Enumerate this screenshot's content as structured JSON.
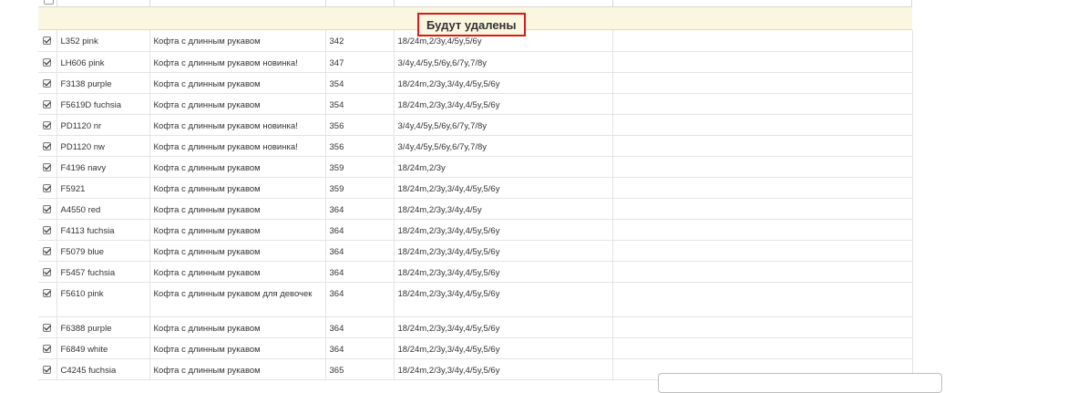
{
  "section": {
    "title": "Будут удалены"
  },
  "rows": [
    {
      "checked": true,
      "article": "L352 pink",
      "name": "Кофта с длинным рукавом",
      "price": "342",
      "sizes": "18/24m,2/3y,4/5y,5/6y"
    },
    {
      "checked": true,
      "article": "LH606 pink",
      "name": "Кофта с длинным рукавом новинка!",
      "price": "347",
      "sizes": "3/4y,4/5y,5/6y,6/7y,7/8y"
    },
    {
      "checked": true,
      "article": "F3138 purple",
      "name": "Кофта с длинным рукавом",
      "price": "354",
      "sizes": "18/24m,2/3y,3/4y,4/5y,5/6y"
    },
    {
      "checked": true,
      "article": "F5619D fuchsia",
      "name": "Кофта с длинным рукавом",
      "price": "354",
      "sizes": "18/24m,2/3y,3/4y,4/5y,5/6y"
    },
    {
      "checked": true,
      "article": "PD1120 nr",
      "name": "Кофта с длинным рукавом новинка!",
      "price": "356",
      "sizes": "3/4y,4/5y,5/6y,6/7y,7/8y"
    },
    {
      "checked": true,
      "article": "PD1120 nw",
      "name": "Кофта с длинным рукавом новинка!",
      "price": "356",
      "sizes": "3/4y,4/5y,5/6y,6/7y,7/8y"
    },
    {
      "checked": true,
      "article": "F4196 navy",
      "name": "Кофта с длинным рукавом",
      "price": "359",
      "sizes": "18/24m,2/3y"
    },
    {
      "checked": true,
      "article": "F5921",
      "name": "Кофта с длинным рукавом",
      "price": "359",
      "sizes": "18/24m,2/3y,3/4y,4/5y,5/6y"
    },
    {
      "checked": true,
      "article": "A4550 red",
      "name": "Кофта с длинным рукавом",
      "price": "364",
      "sizes": "18/24m,2/3y,3/4y,4/5y"
    },
    {
      "checked": true,
      "article": "F4113 fuchsia",
      "name": "Кофта с длинным рукавом",
      "price": "364",
      "sizes": "18/24m,2/3y,3/4y,4/5y,5/6y"
    },
    {
      "checked": true,
      "article": "F5079 blue",
      "name": "Кофта с длинным рукавом",
      "price": "364",
      "sizes": "18/24m,2/3y,3/4y,4/5y,5/6y"
    },
    {
      "checked": true,
      "article": "F5457 fuchsia",
      "name": "Кофта с длинным рукавом",
      "price": "364",
      "sizes": "18/24m,2/3y,3/4y,4/5y,5/6y"
    },
    {
      "checked": true,
      "article": "F5610 pink",
      "name": "Кофта с длинным рукавом для девочек",
      "price": "364",
      "sizes": "18/24m,2/3y,3/4y,4/5y,5/6y"
    },
    {
      "checked": true,
      "article": "F6388 purple",
      "name": "Кофта с длинным рукавом",
      "price": "364",
      "sizes": "18/24m,2/3y,3/4y,4/5y,5/6y"
    },
    {
      "checked": true,
      "article": "F6849 white",
      "name": "Кофта с длинным рукавом",
      "price": "364",
      "sizes": "18/24m,2/3y,3/4y,4/5y,5/6y"
    },
    {
      "checked": true,
      "article": "C4245 fuchsia",
      "name": "Кофта с длинным рукавом",
      "price": "365",
      "sizes": "18/24m,2/3y,3/4y,4/5y,5/6y"
    }
  ],
  "colors": {
    "highlight_border": "#d9191e",
    "section_bg": "#fbf6e0"
  }
}
